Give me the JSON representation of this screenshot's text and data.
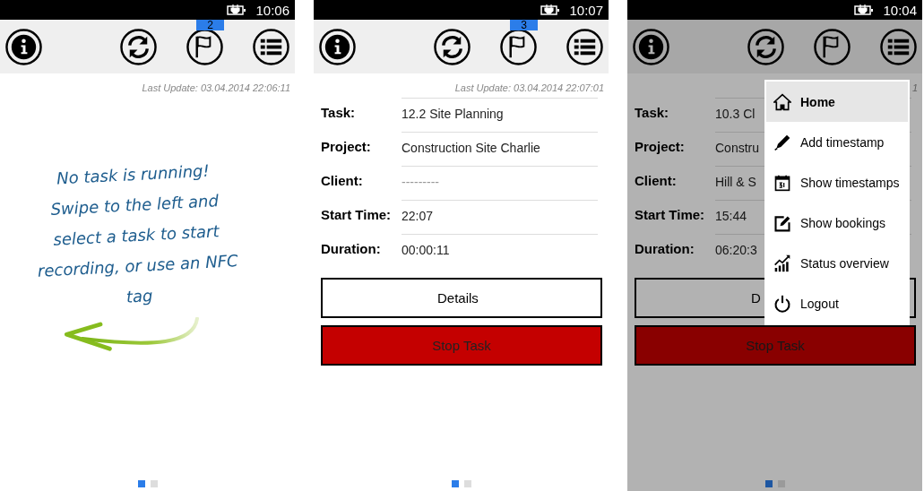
{
  "screens": [
    {
      "status_bar": {
        "time": "10:06"
      },
      "toolbar": {
        "badge": "2"
      },
      "last_update": "Last Update: 03.04.2014 22:06:11",
      "kind": "empty",
      "message": "No task is running! Swipe to the left and select a task to start recording, or use an NFC tag",
      "pages": [
        {
          "selected": true
        },
        {
          "selected": false
        }
      ],
      "dimmed": false
    },
    {
      "status_bar": {
        "time": "10:07"
      },
      "toolbar": {
        "badge": "3"
      },
      "last_update": "Last Update: 03.04.2014 22:07:01",
      "kind": "task",
      "fields": [
        {
          "label": "Task:",
          "value": "12.2 Site Planning",
          "muted": false
        },
        {
          "label": "Project:",
          "value": "Construction Site Charlie",
          "muted": false
        },
        {
          "label": "Client:",
          "value": "---------",
          "muted": true
        },
        {
          "label": "Start Time:",
          "value": "22:07",
          "muted": false
        },
        {
          "label": "Duration:",
          "value": "00:00:11",
          "muted": false
        }
      ],
      "buttons": [
        {
          "label": "Details",
          "kind": "outline"
        },
        {
          "label": "Stop Task",
          "kind": "danger"
        }
      ],
      "pages": [
        {
          "selected": true
        },
        {
          "selected": false
        }
      ],
      "dimmed": false
    },
    {
      "status_bar": {
        "time": "10:04"
      },
      "last_update": "1",
      "kind": "task",
      "fields": [
        {
          "label": "Task:",
          "value": "10.3 Cl",
          "muted": false
        },
        {
          "label": "Project:",
          "value": "Constru",
          "muted": false
        },
        {
          "label": "Client:",
          "value": "Hill & S",
          "muted": false
        },
        {
          "label": "Start Time:",
          "value": "15:44",
          "muted": false
        },
        {
          "label": "Duration:",
          "value": "06:20:3",
          "muted": false
        }
      ],
      "buttons": [
        {
          "label": "D",
          "kind": "outline"
        },
        {
          "label": "Stop Task",
          "kind": "danger"
        }
      ],
      "pages": [
        {
          "selected": true
        },
        {
          "selected": false
        }
      ],
      "dimmed": true,
      "menu": {
        "items": [
          {
            "label": "Home",
            "selected": true
          },
          {
            "label": "Add timestamp",
            "selected": false
          },
          {
            "label": "Show timestamps",
            "selected": false
          },
          {
            "label": "Show bookings",
            "selected": false
          },
          {
            "label": "Status overview",
            "selected": false
          },
          {
            "label": "Logout",
            "selected": false
          }
        ]
      }
    }
  ]
}
